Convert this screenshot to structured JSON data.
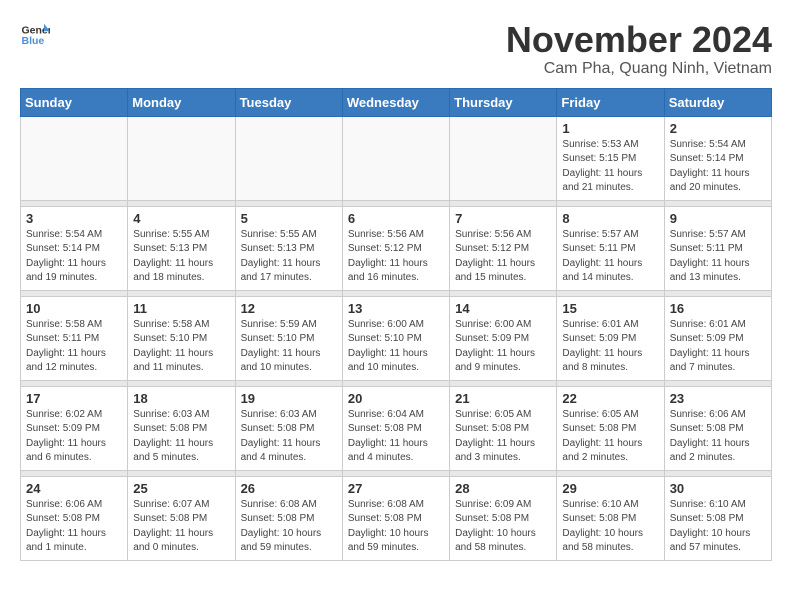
{
  "header": {
    "logo_general": "General",
    "logo_blue": "Blue",
    "month_title": "November 2024",
    "location": "Cam Pha, Quang Ninh, Vietnam"
  },
  "days_of_week": [
    "Sunday",
    "Monday",
    "Tuesday",
    "Wednesday",
    "Thursday",
    "Friday",
    "Saturday"
  ],
  "weeks": [
    {
      "days": [
        {
          "num": "",
          "info": ""
        },
        {
          "num": "",
          "info": ""
        },
        {
          "num": "",
          "info": ""
        },
        {
          "num": "",
          "info": ""
        },
        {
          "num": "",
          "info": ""
        },
        {
          "num": "1",
          "info": "Sunrise: 5:53 AM\nSunset: 5:15 PM\nDaylight: 11 hours\nand 21 minutes."
        },
        {
          "num": "2",
          "info": "Sunrise: 5:54 AM\nSunset: 5:14 PM\nDaylight: 11 hours\nand 20 minutes."
        }
      ]
    },
    {
      "days": [
        {
          "num": "3",
          "info": "Sunrise: 5:54 AM\nSunset: 5:14 PM\nDaylight: 11 hours\nand 19 minutes."
        },
        {
          "num": "4",
          "info": "Sunrise: 5:55 AM\nSunset: 5:13 PM\nDaylight: 11 hours\nand 18 minutes."
        },
        {
          "num": "5",
          "info": "Sunrise: 5:55 AM\nSunset: 5:13 PM\nDaylight: 11 hours\nand 17 minutes."
        },
        {
          "num": "6",
          "info": "Sunrise: 5:56 AM\nSunset: 5:12 PM\nDaylight: 11 hours\nand 16 minutes."
        },
        {
          "num": "7",
          "info": "Sunrise: 5:56 AM\nSunset: 5:12 PM\nDaylight: 11 hours\nand 15 minutes."
        },
        {
          "num": "8",
          "info": "Sunrise: 5:57 AM\nSunset: 5:11 PM\nDaylight: 11 hours\nand 14 minutes."
        },
        {
          "num": "9",
          "info": "Sunrise: 5:57 AM\nSunset: 5:11 PM\nDaylight: 11 hours\nand 13 minutes."
        }
      ]
    },
    {
      "days": [
        {
          "num": "10",
          "info": "Sunrise: 5:58 AM\nSunset: 5:11 PM\nDaylight: 11 hours\nand 12 minutes."
        },
        {
          "num": "11",
          "info": "Sunrise: 5:58 AM\nSunset: 5:10 PM\nDaylight: 11 hours\nand 11 minutes."
        },
        {
          "num": "12",
          "info": "Sunrise: 5:59 AM\nSunset: 5:10 PM\nDaylight: 11 hours\nand 10 minutes."
        },
        {
          "num": "13",
          "info": "Sunrise: 6:00 AM\nSunset: 5:10 PM\nDaylight: 11 hours\nand 10 minutes."
        },
        {
          "num": "14",
          "info": "Sunrise: 6:00 AM\nSunset: 5:09 PM\nDaylight: 11 hours\nand 9 minutes."
        },
        {
          "num": "15",
          "info": "Sunrise: 6:01 AM\nSunset: 5:09 PM\nDaylight: 11 hours\nand 8 minutes."
        },
        {
          "num": "16",
          "info": "Sunrise: 6:01 AM\nSunset: 5:09 PM\nDaylight: 11 hours\nand 7 minutes."
        }
      ]
    },
    {
      "days": [
        {
          "num": "17",
          "info": "Sunrise: 6:02 AM\nSunset: 5:09 PM\nDaylight: 11 hours\nand 6 minutes."
        },
        {
          "num": "18",
          "info": "Sunrise: 6:03 AM\nSunset: 5:08 PM\nDaylight: 11 hours\nand 5 minutes."
        },
        {
          "num": "19",
          "info": "Sunrise: 6:03 AM\nSunset: 5:08 PM\nDaylight: 11 hours\nand 4 minutes."
        },
        {
          "num": "20",
          "info": "Sunrise: 6:04 AM\nSunset: 5:08 PM\nDaylight: 11 hours\nand 4 minutes."
        },
        {
          "num": "21",
          "info": "Sunrise: 6:05 AM\nSunset: 5:08 PM\nDaylight: 11 hours\nand 3 minutes."
        },
        {
          "num": "22",
          "info": "Sunrise: 6:05 AM\nSunset: 5:08 PM\nDaylight: 11 hours\nand 2 minutes."
        },
        {
          "num": "23",
          "info": "Sunrise: 6:06 AM\nSunset: 5:08 PM\nDaylight: 11 hours\nand 2 minutes."
        }
      ]
    },
    {
      "days": [
        {
          "num": "24",
          "info": "Sunrise: 6:06 AM\nSunset: 5:08 PM\nDaylight: 11 hours\nand 1 minute."
        },
        {
          "num": "25",
          "info": "Sunrise: 6:07 AM\nSunset: 5:08 PM\nDaylight: 11 hours\nand 0 minutes."
        },
        {
          "num": "26",
          "info": "Sunrise: 6:08 AM\nSunset: 5:08 PM\nDaylight: 10 hours\nand 59 minutes."
        },
        {
          "num": "27",
          "info": "Sunrise: 6:08 AM\nSunset: 5:08 PM\nDaylight: 10 hours\nand 59 minutes."
        },
        {
          "num": "28",
          "info": "Sunrise: 6:09 AM\nSunset: 5:08 PM\nDaylight: 10 hours\nand 58 minutes."
        },
        {
          "num": "29",
          "info": "Sunrise: 6:10 AM\nSunset: 5:08 PM\nDaylight: 10 hours\nand 58 minutes."
        },
        {
          "num": "30",
          "info": "Sunrise: 6:10 AM\nSunset: 5:08 PM\nDaylight: 10 hours\nand 57 minutes."
        }
      ]
    }
  ]
}
